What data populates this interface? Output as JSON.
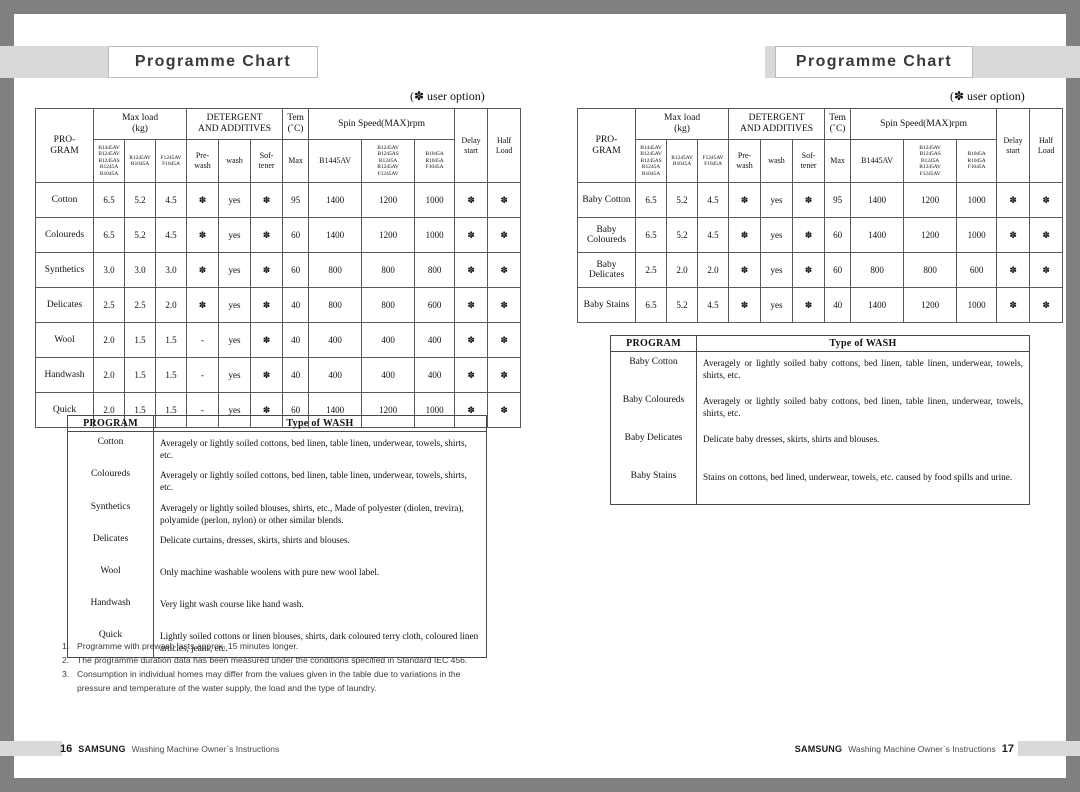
{
  "pages": {
    "left": {
      "title": "Programme Chart",
      "user_option_note": "(✽ user option)",
      "footer": {
        "page_number": "16",
        "brand": "SAMSUNG",
        "subtitle": "Washing Machine Owner`s Instructions"
      }
    },
    "right": {
      "title": "Programme Chart",
      "user_option_note": "(✽ user option)",
      "footer": {
        "page_number": "17",
        "brand": "SAMSUNG",
        "subtitle": "Washing Machine Owner`s Instructions"
      }
    }
  },
  "programme_table": {
    "headers": {
      "program": "PRO-\nGRAM",
      "program_line1": "PRO-",
      "program_line2": "GRAM",
      "max_load": "Max load",
      "max_load_unit": "(kg)",
      "detergent": "DETERGENT",
      "detergent2": "AND ADDITIVES",
      "tem": "Tem",
      "tem_unit": "(˚C)",
      "spin": "Spin Speed(MAX)rpm",
      "delay": "Delay",
      "delay2": "start",
      "half": "Half",
      "half2": "Load",
      "load_models_1": "B1445AV\nB1245AV\nB1245AS\nB1245A\nB1045A",
      "load_models_2": "R1245AV\nR1045A",
      "load_models_3": "F1245AV\nF1045A",
      "prewash": "Pre-\nwash",
      "wash": "wash",
      "softener": "Sof-\ntener",
      "max": "Max",
      "spin_models_1": "B1445AV",
      "spin_models_2": "B1245AV\nB1245AS\nB1245A\nR1245AV\nF1245AV",
      "spin_models_3": "B1045A\nR1045A\nF1045A"
    },
    "left_rows": [
      {
        "program": "Cotton",
        "load1": "6.5",
        "load2": "5.2",
        "load3": "4.5",
        "prewash": "✽",
        "wash": "yes",
        "softener": "✽",
        "temp": "95",
        "spin1": "1400",
        "spin2": "1200",
        "spin3": "1000",
        "delay": "✽",
        "half": "✽"
      },
      {
        "program": "Coloureds",
        "load1": "6.5",
        "load2": "5.2",
        "load3": "4.5",
        "prewash": "✽",
        "wash": "yes",
        "softener": "✽",
        "temp": "60",
        "spin1": "1400",
        "spin2": "1200",
        "spin3": "1000",
        "delay": "✽",
        "half": "✽"
      },
      {
        "program": "Synthetics",
        "load1": "3.0",
        "load2": "3.0",
        "load3": "3.0",
        "prewash": "✽",
        "wash": "yes",
        "softener": "✽",
        "temp": "60",
        "spin1": "800",
        "spin2": "800",
        "spin3": "800",
        "delay": "✽",
        "half": "✽"
      },
      {
        "program": "Delicates",
        "load1": "2.5",
        "load2": "2.5",
        "load3": "2.0",
        "prewash": "✽",
        "wash": "yes",
        "softener": "✽",
        "temp": "40",
        "spin1": "800",
        "spin2": "800",
        "spin3": "600",
        "delay": "✽",
        "half": "✽"
      },
      {
        "program": "Wool",
        "load1": "2.0",
        "load2": "1.5",
        "load3": "1.5",
        "prewash": "-",
        "wash": "yes",
        "softener": "✽",
        "temp": "40",
        "spin1": "400",
        "spin2": "400",
        "spin3": "400",
        "delay": "✽",
        "half": "✽"
      },
      {
        "program": "Handwash",
        "load1": "2.0",
        "load2": "1.5",
        "load3": "1.5",
        "prewash": "-",
        "wash": "yes",
        "softener": "✽",
        "temp": "40",
        "spin1": "400",
        "spin2": "400",
        "spin3": "400",
        "delay": "✽",
        "half": "✽"
      },
      {
        "program": "Quick",
        "load1": "2.0",
        "load2": "1.5",
        "load3": "1.5",
        "prewash": "-",
        "wash": "yes",
        "softener": "✽",
        "temp": "60",
        "spin1": "1400",
        "spin2": "1200",
        "spin3": "1000",
        "delay": "✽",
        "half": "✽"
      }
    ],
    "right_rows": [
      {
        "program": "Baby Cotton",
        "load1": "6.5",
        "load2": "5.2",
        "load3": "4.5",
        "prewash": "✽",
        "wash": "yes",
        "softener": "✽",
        "temp": "95",
        "spin1": "1400",
        "spin2": "1200",
        "spin3": "1000",
        "delay": "✽",
        "half": "✽"
      },
      {
        "program": "Baby\nColoureds",
        "load1": "6.5",
        "load2": "5.2",
        "load3": "4.5",
        "prewash": "✽",
        "wash": "yes",
        "softener": "✽",
        "temp": "60",
        "spin1": "1400",
        "spin2": "1200",
        "spin3": "1000",
        "delay": "✽",
        "half": "✽"
      },
      {
        "program": "Baby\nDelicates",
        "load1": "2.5",
        "load2": "2.0",
        "load3": "2.0",
        "prewash": "✽",
        "wash": "yes",
        "softener": "✽",
        "temp": "60",
        "spin1": "800",
        "spin2": "800",
        "spin3": "600",
        "delay": "✽",
        "half": "✽"
      },
      {
        "program": "Baby Stains",
        "load1": "6.5",
        "load2": "5.2",
        "load3": "4.5",
        "prewash": "✽",
        "wash": "yes",
        "softener": "✽",
        "temp": "40",
        "spin1": "1400",
        "spin2": "1200",
        "spin3": "1000",
        "delay": "✽",
        "half": "✽"
      }
    ]
  },
  "wash_table": {
    "header_program": "PROGRAM",
    "header_type": "Type of  WASH",
    "left_rows": [
      {
        "program": "Cotton",
        "desc": "Averagely or lightly soiled cottons, bed linen, table linen, underwear, towels, shirts, etc."
      },
      {
        "program": "Coloureds",
        "desc": "Averagely or lightly soiled cottons, bed linen, table linen, underwear, towels, shirts, etc."
      },
      {
        "program": "Synthetics",
        "desc": "Averagely or lightly soiled blouses, shirts, etc., Made of polyester (diolen, trevira), polyamide (perlon, nylon) or other similar blends."
      },
      {
        "program": "Delicates",
        "desc": "Delicate curtains, dresses, skirts, shirts and blouses."
      },
      {
        "program": "Wool",
        "desc": "Only machine washable woolens with pure new wool label."
      },
      {
        "program": "Handwash",
        "desc": "Very light wash course like hand wash."
      },
      {
        "program": "Quick",
        "desc": "Lightly soiled cottons or linen blouses, shirts, dark coloured terry cloth, coloured linen articles, jeans, etc."
      }
    ],
    "right_rows": [
      {
        "program": "Baby Cotton",
        "desc": "Averagely or lightly soiled baby cottons, bed linen, table linen, underwear, towels, shirts, etc."
      },
      {
        "program": "Baby Coloureds",
        "desc": "Averagely or lightly soiled baby cottons, bed linen, table linen, underwear, towels, shirts, etc."
      },
      {
        "program": "Baby Delicates",
        "desc": "Delicate baby dresses, skirts, shirts and blouses."
      },
      {
        "program": "Baby Stains",
        "desc": "Stains on cottons, bed lined, underwear, towels, etc. caused by food spills and urine."
      }
    ]
  },
  "notes": [
    {
      "num": "1.",
      "text": "Programme with prewash lasts approx. 15 minutes longer."
    },
    {
      "num": "2.",
      "text": "The programme duration data has been measured under the conditions specified in Standard IEC 456."
    },
    {
      "num": "3.",
      "text": "Consumption in individual homes may differ from the values given in the table due to variations in the pressure and temperature of the water supply, the load and the type of laundry."
    }
  ],
  "colors": {
    "frame_gray": "#808080",
    "banner_gray": "#d9d9d9",
    "text": "#101010"
  }
}
